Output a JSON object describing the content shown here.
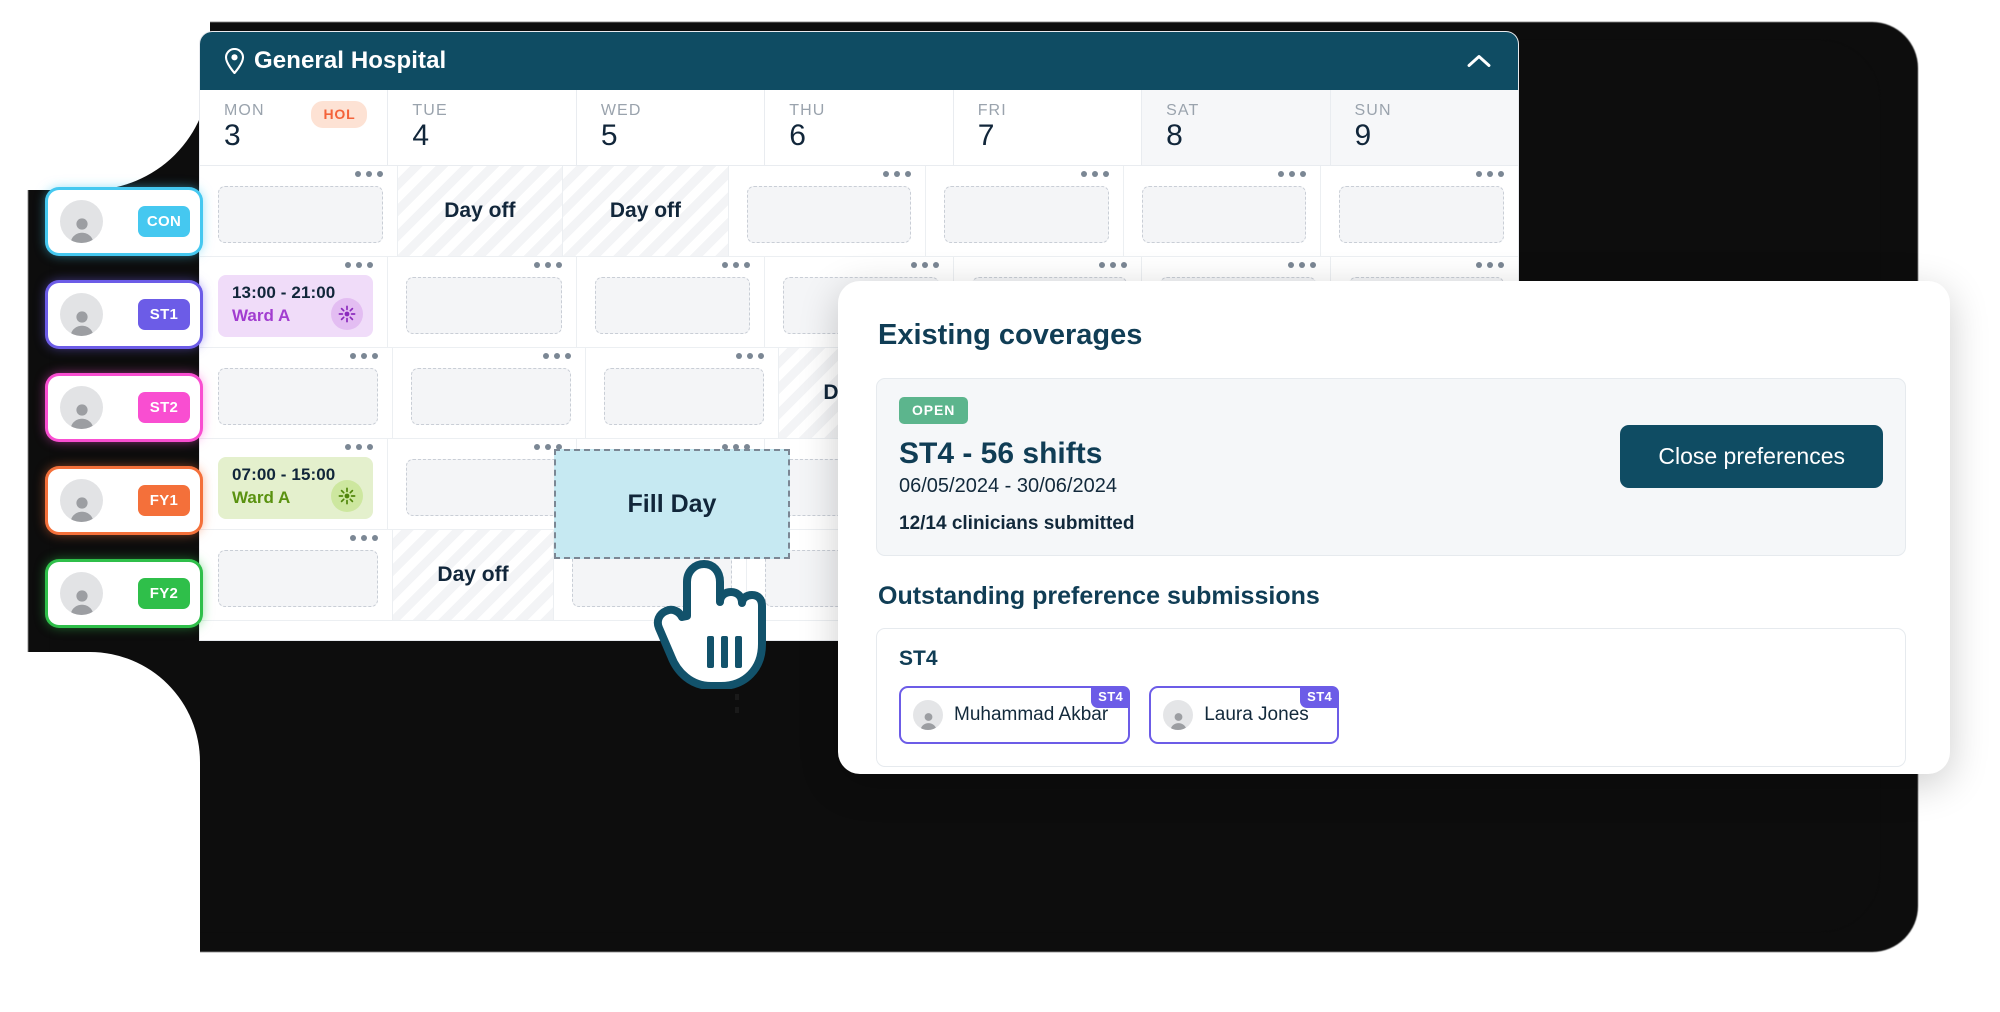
{
  "backdrop": {
    "color": "#0d0d0d"
  },
  "staff_rail": {
    "items": [
      {
        "badge": "CON",
        "badge_color": "#45c8f0",
        "ring": "#45c8f0",
        "avatar_icon": "person-icon"
      },
      {
        "badge": "ST1",
        "badge_color": "#6c5ce7",
        "ring": "#6c5ce7",
        "avatar_icon": "person-icon"
      },
      {
        "badge": "ST2",
        "badge_color": "#f94ed1",
        "ring": "#f94ed1",
        "avatar_icon": "person-icon"
      },
      {
        "badge": "FY1",
        "badge_color": "#f4703a",
        "ring": "#f4703a",
        "avatar_icon": "person-icon"
      },
      {
        "badge": "FY2",
        "badge_color": "#2fbf4a",
        "ring": "#2fbf4a",
        "avatar_icon": "person-icon"
      }
    ]
  },
  "calendar": {
    "header": {
      "title": "General Hospital",
      "location_icon": "map-pin-icon",
      "collapse_icon": "chevron-up-icon",
      "bar_color": "#0f4c63"
    },
    "days": [
      {
        "dow": "MON",
        "num": "3",
        "weekend": false,
        "badge": "HOL"
      },
      {
        "dow": "TUE",
        "num": "4",
        "weekend": false,
        "badge": null
      },
      {
        "dow": "WED",
        "num": "5",
        "weekend": false,
        "badge": null
      },
      {
        "dow": "THU",
        "num": "6",
        "weekend": false,
        "badge": null
      },
      {
        "dow": "FRI",
        "num": "7",
        "weekend": false,
        "badge": null
      },
      {
        "dow": "SAT",
        "num": "8",
        "weekend": true,
        "badge": null
      },
      {
        "dow": "SUN",
        "num": "9",
        "weekend": true,
        "badge": null
      }
    ],
    "day_off_label": "Day off",
    "rows": [
      {
        "cells": [
          {
            "type": "empty"
          },
          {
            "type": "dayoff"
          },
          {
            "type": "dayoff"
          },
          {
            "type": "empty"
          },
          {
            "type": "empty"
          },
          {
            "type": "empty"
          },
          {
            "type": "empty"
          }
        ]
      },
      {
        "cells": [
          {
            "type": "shift",
            "time": "13:00 - 21:00",
            "ward": "Ward A",
            "theme": "purple",
            "icon": "night-shift-icon"
          },
          {
            "type": "empty"
          },
          {
            "type": "empty"
          },
          {
            "type": "empty"
          },
          {
            "type": "empty"
          },
          {
            "type": "empty"
          },
          {
            "type": "empty"
          }
        ]
      },
      {
        "cells": [
          {
            "type": "empty"
          },
          {
            "type": "empty"
          },
          {
            "type": "empty"
          },
          {
            "type": "dayoff"
          },
          {
            "type": "empty"
          },
          {
            "type": "empty"
          },
          {
            "type": "empty"
          }
        ]
      },
      {
        "cells": [
          {
            "type": "shift",
            "time": "07:00 - 15:00",
            "ward": "Ward A",
            "theme": "green",
            "icon": "day-shift-icon"
          },
          {
            "type": "empty"
          },
          {
            "type": "empty"
          },
          {
            "type": "empty"
          },
          {
            "type": "empty"
          },
          {
            "type": "empty"
          },
          {
            "type": "empty"
          }
        ]
      },
      {
        "cells": [
          {
            "type": "empty"
          },
          {
            "type": "dayoff"
          },
          {
            "type": "empty"
          },
          {
            "type": "empty"
          },
          {
            "type": "empty"
          },
          {
            "type": "empty"
          },
          {
            "type": "empty"
          }
        ]
      }
    ]
  },
  "fill_day": {
    "label": "Fill Day",
    "fill_color": "#c6e9f2"
  },
  "cursor": {
    "icon": "pointing-hand-cursor"
  },
  "coverage": {
    "heading": "Existing coverages",
    "status_pill": "OPEN",
    "status_color": "#5cb58d",
    "title": "ST4 - 56 shifts",
    "dates": "06/05/2024 - 30/06/2024",
    "submitted": "12/14 clinicians submitted",
    "close_button": "Close preferences",
    "submissions_heading": "Outstanding preference submissions",
    "submissions_grade": "ST4",
    "clinicians": [
      {
        "name": "Muhammad Akbar",
        "badge": "ST4",
        "avatar_icon": "person-icon"
      },
      {
        "name": "Laura Jones",
        "badge": "ST4",
        "avatar_icon": "person-icon"
      }
    ]
  }
}
